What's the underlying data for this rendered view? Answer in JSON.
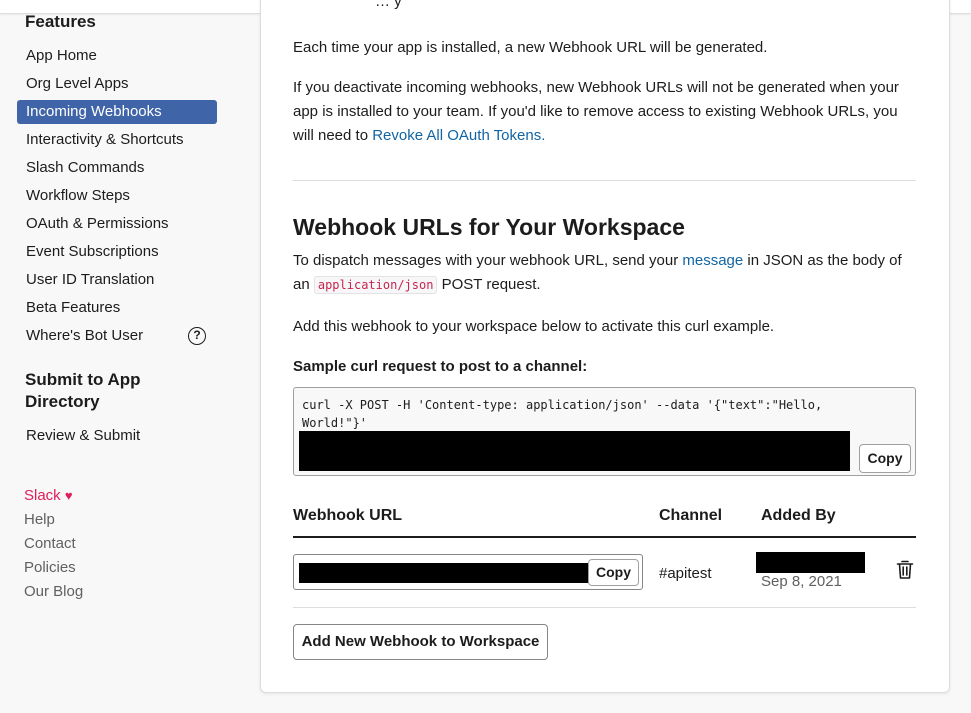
{
  "sidebar": {
    "features_title": "Features",
    "items": [
      {
        "label": "App Home"
      },
      {
        "label": "Org Level Apps"
      },
      {
        "label": "Incoming Webhooks",
        "active": true
      },
      {
        "label": "Interactivity & Shortcuts"
      },
      {
        "label": "Slash Commands"
      },
      {
        "label": "Workflow Steps"
      },
      {
        "label": "OAuth & Permissions"
      },
      {
        "label": "Event Subscriptions"
      },
      {
        "label": "User ID Translation"
      },
      {
        "label": "Beta Features"
      },
      {
        "label": "Where's Bot User",
        "icon": "help-circle-icon"
      }
    ],
    "help_icon_glyph": "?",
    "submit_title_line1": "Submit to App",
    "submit_title_line2": "Directory",
    "submit_items": [
      {
        "label": "Review & Submit"
      }
    ],
    "footer": {
      "slack": "Slack",
      "heart": "♥",
      "links": [
        "Help",
        "Contact",
        "Policies",
        "Our Blog"
      ]
    }
  },
  "main": {
    "partial_top_text": "… y",
    "para_generated": "Each time your app is installed, a new Webhook URL will be generated.",
    "para_deactivate": "If you deactivate incoming webhooks, new Webhook URLs will not be generated when your app is installed to your team. If you'd like to remove access to existing Webhook URLs, you will need to",
    "revoke_link": "Revoke All OAuth Tokens.",
    "section_title": "Webhook URLs for Your Workspace",
    "dispatch_pre": "To dispatch messages with your webhook URL, send your",
    "dispatch_link": "message",
    "dispatch_mid": "in JSON as the body of an",
    "dispatch_code": "application/json",
    "dispatch_post": "POST request.",
    "add_instruction": "Add this webhook to your workspace below to activate this curl example.",
    "sample_label": "Sample curl request to post to a channel:",
    "curl_text": "curl -X POST -H 'Content-type: application/json' --data '{\"text\":\"Hello, World!\"}'",
    "copy_label": "Copy",
    "table": {
      "headers": [
        "Webhook URL",
        "Channel",
        "Added By"
      ],
      "row": {
        "channel": "#apitest",
        "date": "Sep 8, 2021"
      }
    },
    "add_button": "Add New Webhook to Workspace"
  }
}
